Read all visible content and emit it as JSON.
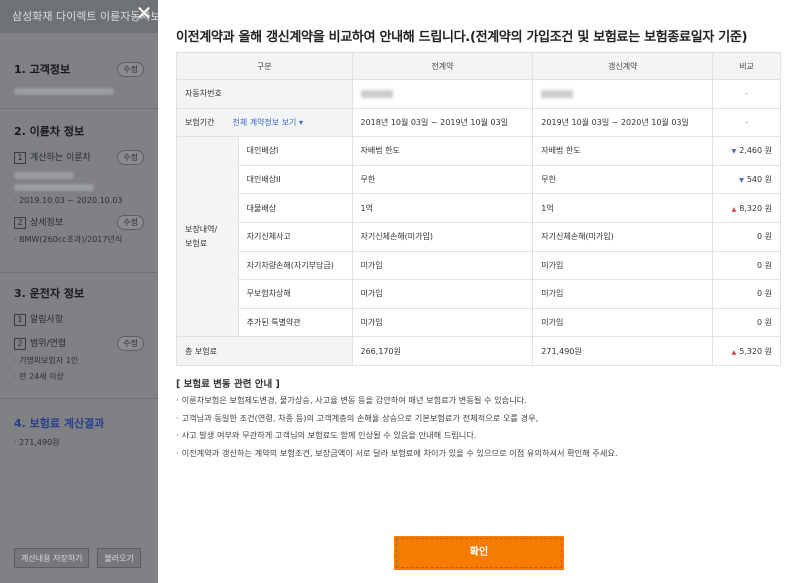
{
  "sidebar": {
    "title": "삼성화재 다이렉트 이륜자동차보험",
    "edit_label": "수정",
    "sections": {
      "customer": {
        "title": "1. 고객정보"
      },
      "vehicle": {
        "title": "2. 이륜차 정보",
        "sub1": "계산하는 이륜차",
        "period": "· 2019.10.03 ~ 2020.10.03",
        "sub2": "상세정보",
        "model": "· BMW(260cc초과)/2017년식"
      },
      "driver": {
        "title": "3. 운전자 정보",
        "sub1": "알림사항",
        "sub2": "범위/연령",
        "line1": "· 기명피보험자 1인",
        "line2": "· 만 24세 이상"
      },
      "result": {
        "title": "4. 보험료 계산결과",
        "amount": "· 271,490원"
      }
    },
    "buttons": {
      "save": "계산내용 저장하기",
      "load": "불러오기"
    }
  },
  "modal": {
    "title": "이전계약과 올해 갱신계약을 비교하여 안내해 드립니다.(전계약의 가입조건 및 보험료는 보험종료일자 기준)",
    "table": {
      "headers": {
        "category": "구분",
        "prev": "전계약",
        "renew": "갱신계약",
        "diff": "비교"
      },
      "vehicle_no_label": "자동차번호",
      "vehicle_no_diff": "-",
      "period_label": "보험기간",
      "period_link": "전체 계약정보 보기 ▾",
      "period_prev": "2018년 10월 03일 ~ 2019년 10월 03일",
      "period_renew": "2019년 10월 03일 ~ 2020년 10월 03일",
      "period_diff": "-",
      "coverage_group": "보장내역/\n보험료",
      "coverages": [
        {
          "name": "대인배상I",
          "prev": "자배법 한도",
          "renew": "자배법 한도",
          "dir": "down",
          "diff": "2,460 원"
        },
        {
          "name": "대인배상II",
          "prev": "무한",
          "renew": "무한",
          "dir": "down",
          "diff": "540 원"
        },
        {
          "name": "대물배상",
          "prev": "1억",
          "renew": "1억",
          "dir": "up",
          "diff": "8,320 원"
        },
        {
          "name": "자기신체사고",
          "prev": "자기신체손해(미가입)",
          "renew": "자기신체손해(미가입)",
          "dir": "",
          "diff": "0 원"
        },
        {
          "name": "자기차량손해(자기부담금)",
          "prev": "미가입",
          "renew": "미가입",
          "dir": "",
          "diff": "0 원"
        },
        {
          "name": "무보험차상해",
          "prev": "미가입",
          "renew": "미가입",
          "dir": "",
          "diff": "0 원"
        },
        {
          "name": "추가된 특별약관",
          "prev": "미가입",
          "renew": "미가입",
          "dir": "",
          "diff": "0 원"
        }
      ],
      "total_label": "총 보험료",
      "total_prev": "266,170원",
      "total_renew": "271,490원",
      "total_dir": "up",
      "total_diff": "5,320 원"
    },
    "notice_title": "[ 보험료 변동 관련 안내 ]",
    "notices": [
      "이륜차보험은 보험제도변경, 물가상승, 사고율 변동 등을 감안하여 매년 보험료가 변동될 수 있습니다.",
      "고객님과 동일한 조건(연령, 차종 등)의 고객계층의 손해율 상승으로 기본보험료가 전체적으로 오를 경우,",
      "사고 발생 여부와 무관하게 고객님의 보험료도 함께 인상될 수 있음을 안내해 드립니다.",
      "이전계약과 갱신하는 계약의 보험조건, 보장금액이 서로 달라 보험료에 차이가 있을 수 있으므로 이점 유의하셔서 확인해 주세요."
    ],
    "confirm_label": "확인"
  },
  "icons": {
    "close": "close-icon",
    "up": "triangle-up-icon",
    "down": "triangle-down-icon"
  },
  "colors": {
    "accent": "#f57c00",
    "increase": "#d33b3b",
    "decrease": "#3a66c6"
  }
}
